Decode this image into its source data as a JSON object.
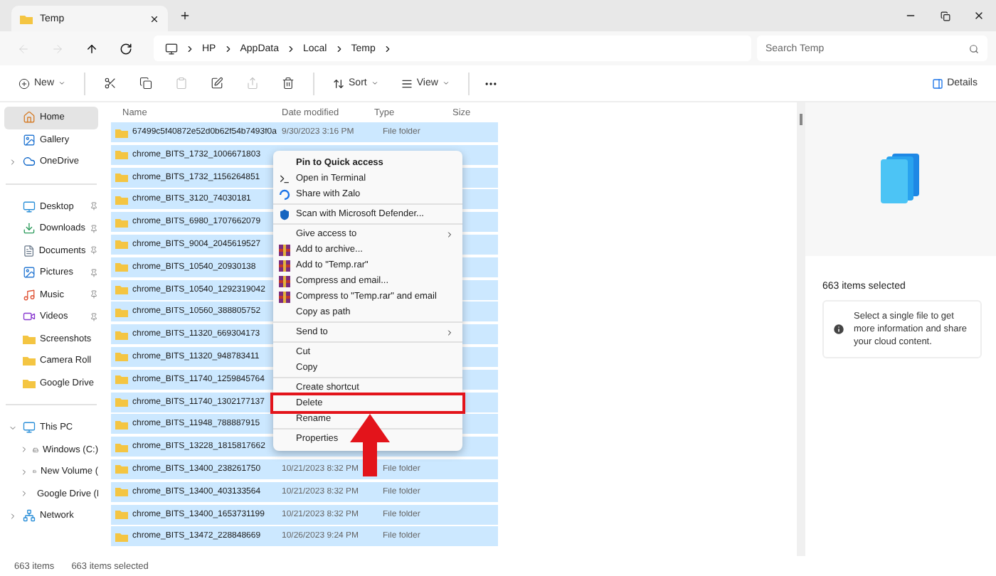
{
  "window": {
    "tab": {
      "title": "Temp"
    }
  },
  "nav": [
    {
      "kind": "back",
      "disabled": true
    },
    {
      "kind": "forward",
      "disabled": true
    },
    {
      "kind": "up",
      "disabled": false
    },
    {
      "kind": "refresh",
      "disabled": false
    }
  ],
  "breadcrumb": [
    "HP",
    "AppData",
    "Local",
    "Temp"
  ],
  "search": {
    "placeholder": "Search Temp"
  },
  "toolbar": {
    "new_label": "New",
    "actions": [
      {
        "kind": "cut",
        "disabled": false
      },
      {
        "kind": "copy",
        "disabled": false
      },
      {
        "kind": "paste",
        "disabled": true
      },
      {
        "kind": "rename",
        "disabled": false
      },
      {
        "kind": "share",
        "disabled": true
      },
      {
        "kind": "delete",
        "disabled": false
      }
    ],
    "sort_label": "Sort",
    "view_label": "View",
    "details_label": "Details"
  },
  "sidebar": {
    "sections": [
      {
        "items": [
          {
            "label": "Home",
            "kind": "home",
            "selected": true
          },
          {
            "label": "Gallery",
            "kind": "gallery",
            "selected": false
          },
          {
            "label": "OneDrive",
            "kind": "cloud",
            "selected": false,
            "expanded": false
          }
        ]
      },
      {
        "items": [
          {
            "label": "Desktop",
            "kind": "desktop",
            "selected": false,
            "pinned": true
          },
          {
            "label": "Downloads",
            "kind": "download",
            "selected": false,
            "pinned": true
          },
          {
            "label": "Documents",
            "kind": "document",
            "selected": false,
            "pinned": true
          },
          {
            "label": "Pictures",
            "kind": "picture",
            "selected": false,
            "pinned": true
          },
          {
            "label": "Music",
            "kind": "music",
            "selected": false,
            "pinned": true
          },
          {
            "label": "Videos",
            "kind": "video",
            "selected": false,
            "pinned": true
          },
          {
            "label": "Screenshots",
            "kind": "folder",
            "selected": false,
            "pinned": false
          },
          {
            "label": "Camera Roll",
            "kind": "folder",
            "selected": false,
            "pinned": false
          },
          {
            "label": "Google Drive",
            "kind": "folder",
            "selected": false,
            "pinned": false
          }
        ]
      },
      {
        "items": [
          {
            "label": "This PC",
            "kind": "pc",
            "selected": false,
            "expanded": true,
            "children": [
              {
                "label": "Windows (C:)",
                "kind": "drive",
                "selected": false,
                "expanded": false
              },
              {
                "label": "New Volume (",
                "kind": "drive",
                "selected": false,
                "expanded": false
              },
              {
                "label": "Google Drive (I",
                "kind": "gdrive",
                "selected": false,
                "expanded": false
              }
            ]
          },
          {
            "label": "Network",
            "kind": "network",
            "selected": false,
            "expanded": false
          }
        ]
      }
    ]
  },
  "table": {
    "columns": [
      "Name",
      "Date modified",
      "Type",
      "Size"
    ],
    "rows": [
      {
        "name": "67499c5f40872e52d0b62f54b7493f0a",
        "date": "9/30/2023 3:16 PM",
        "type": "File folder",
        "selected": true
      },
      {
        "name": "chrome_BITS_1732_1006671803",
        "selected": true
      },
      {
        "name": "chrome_BITS_1732_1156264851",
        "selected": true
      },
      {
        "name": "chrome_BITS_3120_74030181",
        "selected": true
      },
      {
        "name": "chrome_BITS_6980_1707662079",
        "selected": true
      },
      {
        "name": "chrome_BITS_9004_2045619527",
        "selected": true
      },
      {
        "name": "chrome_BITS_10540_20930138",
        "selected": true
      },
      {
        "name": "chrome_BITS_10540_1292319042",
        "selected": true
      },
      {
        "name": "chrome_BITS_10560_388805752",
        "selected": true
      },
      {
        "name": "chrome_BITS_11320_669304173",
        "selected": true
      },
      {
        "name": "chrome_BITS_11320_948783411",
        "selected": true
      },
      {
        "name": "chrome_BITS_11740_1259845764",
        "selected": true
      },
      {
        "name": "chrome_BITS_11740_1302177137",
        "selected": true
      },
      {
        "name": "chrome_BITS_11948_788887915",
        "selected": true
      },
      {
        "name": "chrome_BITS_13228_1815817662",
        "selected": true
      },
      {
        "name": "chrome_BITS_13400_238261750",
        "date": "10/21/2023 8:32 PM",
        "type": "File folder",
        "selected": true
      },
      {
        "name": "chrome_BITS_13400_403133564",
        "date": "10/21/2023 8:32 PM",
        "type": "File folder",
        "selected": true
      },
      {
        "name": "chrome_BITS_13400_1653731199",
        "date": "10/21/2023 8:32 PM",
        "type": "File folder",
        "selected": true
      },
      {
        "name": "chrome_BITS_13472_228848669",
        "date": "10/26/2023 9:24 PM",
        "type": "File folder",
        "selected": true
      }
    ]
  },
  "context_menu": {
    "groups": [
      [
        {
          "label": "Pin to Quick access",
          "kind": "pin",
          "highlighted": false
        },
        {
          "label": "Open in Terminal",
          "kind": "terminal",
          "highlighted": false
        },
        {
          "label": "Share with Zalo",
          "kind": "share",
          "highlighted": false
        }
      ],
      [
        {
          "label": "Scan with Microsoft Defender...",
          "kind": "scan",
          "highlighted": false
        }
      ],
      [
        {
          "label": "Give access to",
          "kind": "submenu",
          "highlighted": false
        },
        {
          "label": "Add to archive...",
          "kind": "archive",
          "highlighted": false
        },
        {
          "label": "Add to \"Temp.rar\"",
          "kind": "archive",
          "highlighted": false
        },
        {
          "label": "Compress and email...",
          "kind": "archive",
          "highlighted": false
        },
        {
          "label": "Compress to \"Temp.rar\" and email",
          "kind": "archive",
          "highlighted": false
        },
        {
          "label": "Copy as path",
          "kind": "plain",
          "highlighted": false
        }
      ],
      [
        {
          "label": "Send to",
          "kind": "submenu",
          "highlighted": false
        }
      ],
      [
        {
          "label": "Cut",
          "kind": "plain",
          "highlighted": false
        },
        {
          "label": "Copy",
          "kind": "plain",
          "highlighted": false
        }
      ],
      [
        {
          "label": "Create shortcut",
          "kind": "plain",
          "highlighted": false
        },
        {
          "label": "Delete",
          "kind": "plain",
          "highlighted": true
        },
        {
          "label": "Rename",
          "kind": "plain",
          "highlighted": false
        }
      ],
      [
        {
          "label": "Properties",
          "kind": "plain",
          "highlighted": false
        }
      ]
    ]
  },
  "details": {
    "title": "663 items selected",
    "info": "Select a single file to get more information and share your cloud content."
  },
  "status_bar": {
    "count": "663 items",
    "selected": "663 items selected"
  }
}
